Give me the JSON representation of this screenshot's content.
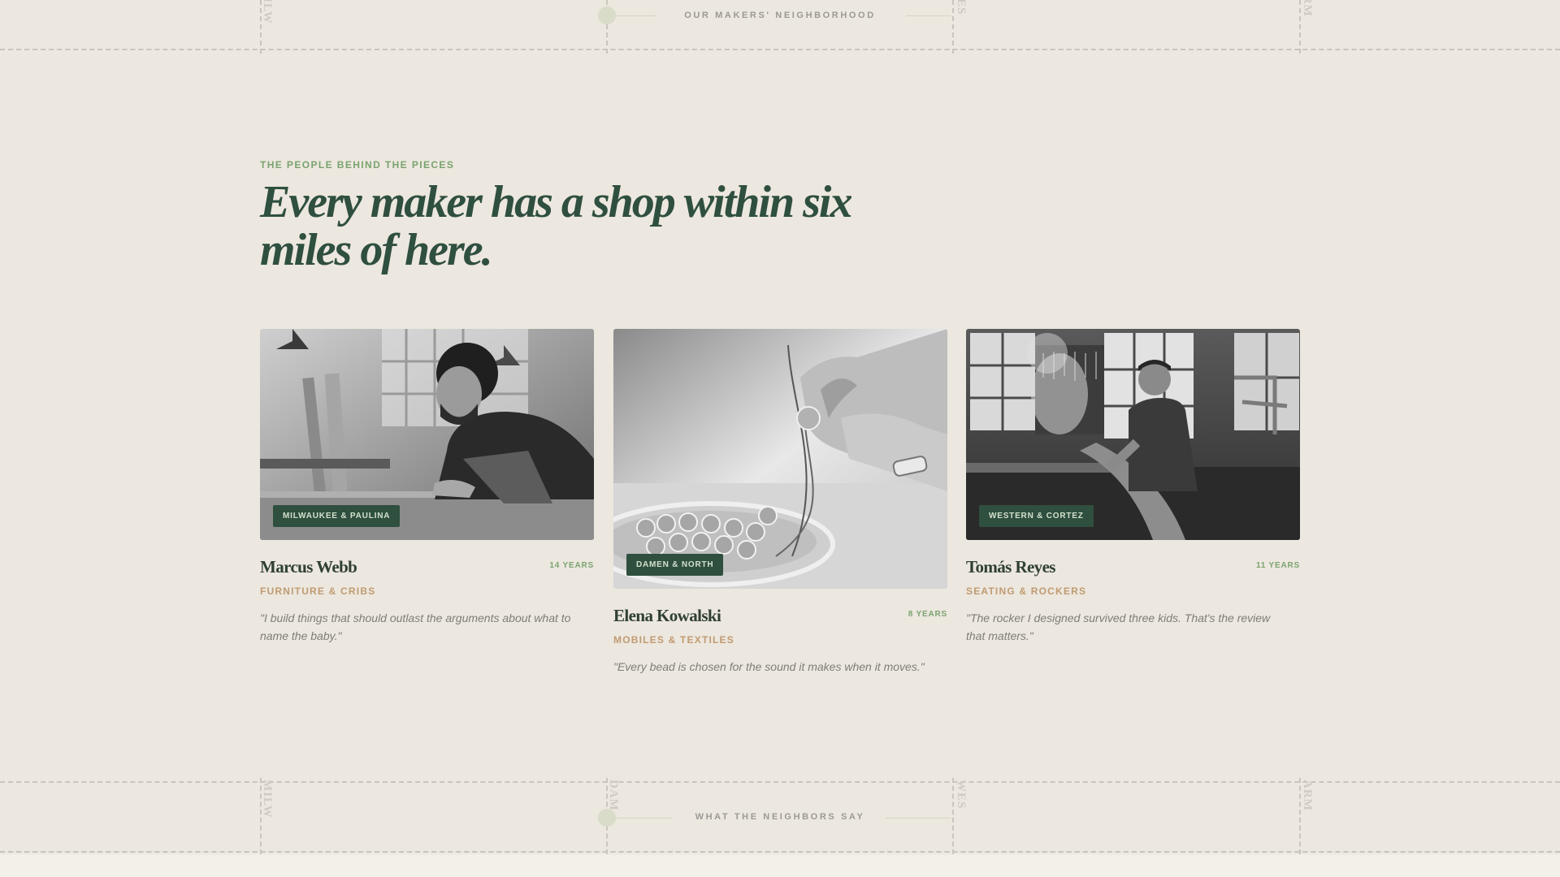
{
  "top_band": {
    "label": "OUR MAKERS' NEIGHBORHOOD",
    "streets": [
      "MILW",
      "DAM",
      "WES",
      "ARM"
    ]
  },
  "section": {
    "eyebrow": "THE PEOPLE BEHIND THE PIECES",
    "headline": "Every maker has a shop within six miles of here."
  },
  "makers": [
    {
      "name": "Marcus Webb",
      "years": "14 YEARS",
      "craft": "FURNITURE & CRIBS",
      "location": "MILWAUKEE & PAULINA",
      "quote": "\"I build things that should outlast the arguments about what to name the baby.\""
    },
    {
      "name": "Elena Kowalski",
      "years": "8 YEARS",
      "craft": "MOBILES & TEXTILES",
      "location": "DAMEN & NORTH",
      "quote": "\"Every bead is chosen for the sound it makes when it moves.\""
    },
    {
      "name": "Tomás Reyes",
      "years": "11 YEARS",
      "craft": "SEATING & ROCKERS",
      "location": "WESTERN & CORTEZ",
      "quote": "\"The rocker I designed survived three kids. That's the review that matters.\""
    }
  ],
  "bottom_band": {
    "label": "WHAT THE NEIGHBORS SAY",
    "streets": [
      "MILW",
      "DAM",
      "WES",
      "ARM"
    ]
  },
  "colors": {
    "background": "#ece7df",
    "forest_green": "#2f4f3f",
    "sage_accent": "#7aa36f",
    "tan_accent": "#c09b71"
  }
}
